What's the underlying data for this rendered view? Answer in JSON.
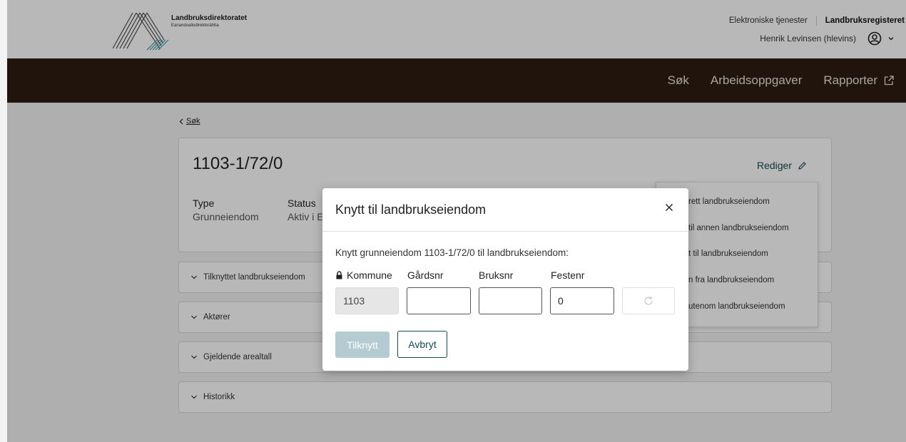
{
  "header": {
    "logo_title": "Landbruksdirektoratet",
    "logo_subtitle": "Eanandoallodirektoráhtta",
    "link_services": "Elektroniske tjenester",
    "link_register": "Landbruksregisteret",
    "user_name": "Henrik Levinsen (hlevins)"
  },
  "nav": {
    "items": [
      {
        "label": "Søk"
      },
      {
        "label": "Arbeidsoppgaver"
      },
      {
        "label": "Rapporter"
      }
    ]
  },
  "breadcrumb": {
    "back_label": "Søk"
  },
  "property": {
    "title": "1103-1/72/0",
    "edit_label": "Rediger",
    "fields": [
      {
        "label": "Type",
        "value": "Grunneiendom"
      },
      {
        "label": "Status",
        "value": "Aktiv i E"
      }
    ]
  },
  "accordions": [
    {
      "label": "Tilknyttet landbrukseiendom"
    },
    {
      "label": "Aktører"
    },
    {
      "label": "Gjeldende arealtall"
    },
    {
      "label": "Historikk"
    }
  ],
  "menu": {
    "items": [
      {
        "label": "rett landbrukseiendom"
      },
      {
        "label": "til annen landbrukseiendom"
      },
      {
        "label": "t til landbrukseiendom"
      },
      {
        "label": "n fra landbrukseiendom"
      },
      {
        "label": "utenom landbrukseiendom"
      }
    ]
  },
  "modal": {
    "title": "Knytt til landbrukseiendom",
    "description": "Knytt grunneiendom 1103-1/72/0 til landbrukseiendom:",
    "fields": {
      "kommune_label": "Kommune",
      "kommune_value": "1103",
      "gardsnr_label": "Gårdsnr",
      "gardsnr_value": "",
      "bruksnr_label": "Bruksnr",
      "bruksnr_value": "",
      "festenr_label": "Festenr",
      "festenr_value": "0"
    },
    "confirm_label": "Tilknytt",
    "cancel_label": "Avbryt"
  },
  "icons": {
    "user": "user-circle-icon",
    "external": "external-link-icon",
    "edit": "pencil-icon",
    "lock": "lock-icon",
    "refresh": "refresh-icon",
    "close": "close-icon"
  },
  "colors": {
    "navbar": "#2e1c11",
    "accent": "#17494f",
    "primary_disabled": "#b4ccd1"
  }
}
